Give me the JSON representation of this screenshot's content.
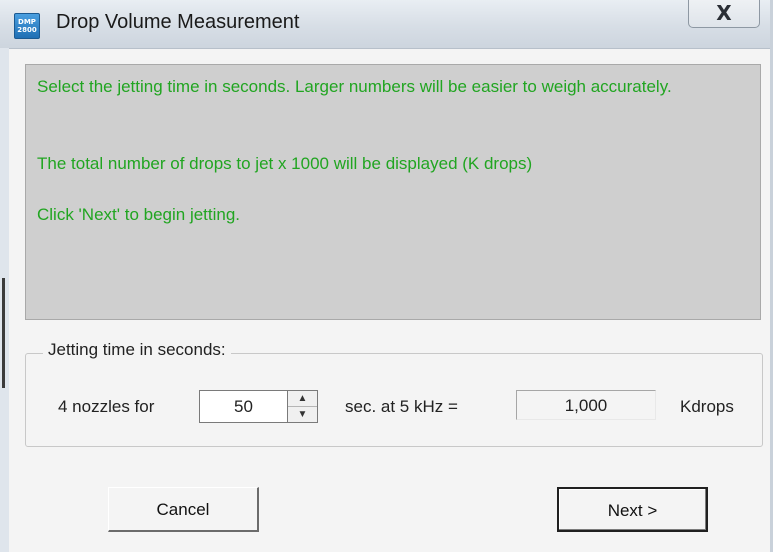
{
  "window": {
    "title": "Drop Volume Measurement",
    "icon_text": "DMP 2800",
    "close_label": "X"
  },
  "message": {
    "line1": "Select the jetting time in seconds. Larger numbers will be easier to weigh accurately.",
    "line2": "The total number of drops to jet x 1000 will be displayed (K drops)",
    "line3": "Click 'Next' to begin jetting."
  },
  "jetting": {
    "group_label": "Jetting time in seconds:",
    "nozzles_label": "4 nozzles for",
    "seconds_value": "50",
    "freq_label": "sec. at 5 kHz =",
    "kdrops_value": "1,000",
    "kdrops_unit": "Kdrops"
  },
  "buttons": {
    "cancel": "Cancel",
    "next": "Next >"
  },
  "colors": {
    "message_text": "#21a521",
    "panel_bg": "#cfcfcf",
    "dialog_bg": "#f4f4f4"
  }
}
